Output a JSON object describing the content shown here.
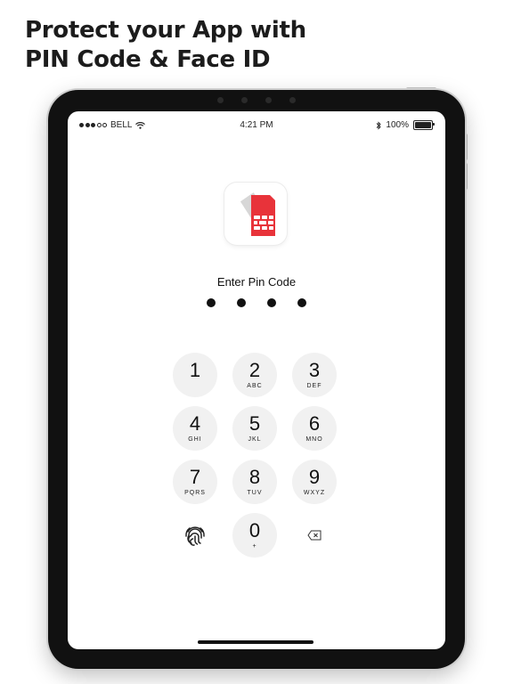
{
  "headline": {
    "line1": "Protect your App with",
    "line2": "PIN Code & Face ID"
  },
  "status_bar": {
    "carrier": "BELL",
    "time": "4:21 PM",
    "battery": "100%",
    "battery_level": 1.0
  },
  "app": {
    "icon": "sim-card-icon",
    "brand_color": "#e8333a",
    "prompt": "Enter Pin Code",
    "pin_length": 4
  },
  "keypad": {
    "keys": [
      {
        "digit": "1",
        "letters": ""
      },
      {
        "digit": "2",
        "letters": "ABC"
      },
      {
        "digit": "3",
        "letters": "DEF"
      },
      {
        "digit": "4",
        "letters": "GHI"
      },
      {
        "digit": "5",
        "letters": "JKL"
      },
      {
        "digit": "6",
        "letters": "MNO"
      },
      {
        "digit": "7",
        "letters": "PQRS"
      },
      {
        "digit": "8",
        "letters": "TUV"
      },
      {
        "digit": "9",
        "letters": "WXYZ"
      },
      {
        "digit": "0",
        "letters": "+"
      }
    ],
    "biometric_icon": "fingerprint-icon",
    "delete_icon": "delete-backspace-icon"
  }
}
